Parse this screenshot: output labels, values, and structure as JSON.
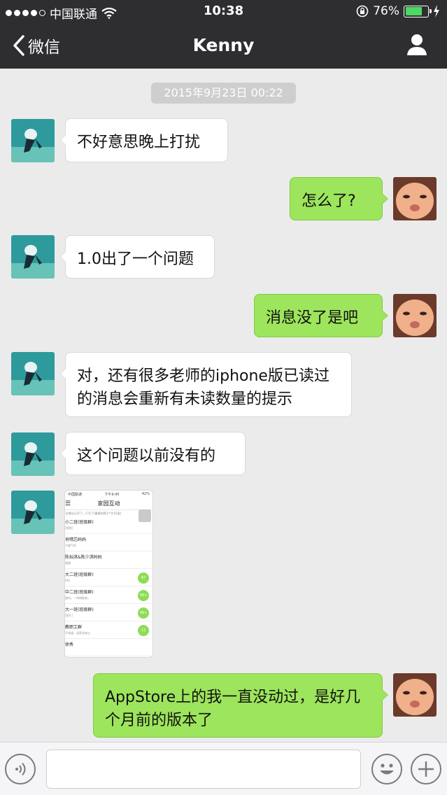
{
  "status_bar": {
    "carrier": "中国联通",
    "time": "10:38",
    "battery": "76%",
    "battery_level": 0.76
  },
  "nav": {
    "back_label": "微信",
    "title": "Kenny"
  },
  "timestamp": "2015年9月23日 00:22",
  "messages": [
    {
      "dir": "in",
      "text": "不好意思晚上打扰"
    },
    {
      "dir": "out",
      "text": "怎么了?"
    },
    {
      "dir": "in",
      "text": "1.0出了一个问题"
    },
    {
      "dir": "out",
      "text": "消息没了是吧"
    },
    {
      "dir": "in",
      "text": "对，还有很多老师的iphone版已读过的消息会重新有未读数量的提示"
    },
    {
      "dir": "in",
      "text": "这个问题以前没有的"
    },
    {
      "dir": "out",
      "text": "AppStore上的我一直没动过，是好几个月前的版本了"
    }
  ],
  "screenshot": {
    "status_carrier": "中国联通",
    "status_time": "下午9:45",
    "status_battery": "42%",
    "title": "家园互动",
    "notice": "好像忘记写了。只写了[最棒的我3个字]可爱]",
    "rows": [
      {
        "name": "小二班(班级群)",
        "sub": "[视频]",
        "badge": ""
      },
      {
        "name": "肖晴芯妈妈",
        "sub": "不客气的",
        "badge": ""
      },
      {
        "name": "陈灿淇&陈少淇妈妈",
        "sub": "谢谢",
        "badge": ""
      },
      {
        "name": "大二班(班级群)",
        "sub": "OK]",
        "badge": "87"
      },
      {
        "name": "中二班(班级群)",
        "sub": "意的。一举稀能来。",
        "badge": "99+"
      },
      {
        "name": "大一班(班级群)",
        "sub": "[图片]",
        "badge": "99+"
      },
      {
        "name": "教职工群",
        "sub": "不知道，说是说来过",
        "badge": "12"
      },
      {
        "name": "徐秀",
        "sub": "",
        "badge": ""
      }
    ]
  },
  "colors": {
    "nav_bg": "#2e2e31",
    "chat_bg": "#ebebeb",
    "out_bubble": "#9de55c",
    "in_bubble": "#ffffff"
  }
}
